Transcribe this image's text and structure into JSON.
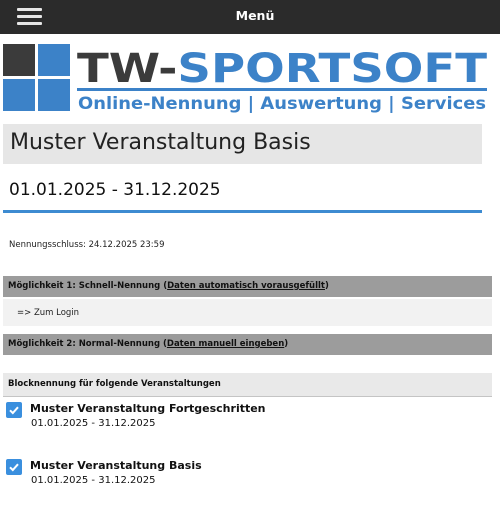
{
  "header": {
    "menu_label": "Menü",
    "menu_icon": "hamburger-menu-icon"
  },
  "logo": {
    "name": "TW-SPORTSOFT",
    "tagline": "Online-Nennung | Auswertung | Services",
    "colors": {
      "dark": "#3b3b3b",
      "blue": "#3c82c8"
    }
  },
  "event": {
    "title": "Muster Veranstaltung Basis",
    "dates": "01.01.2025 - 31.12.2025",
    "deadline": "Nennungsschluss: 24.12.2025 23:59"
  },
  "options": {
    "option1_prefix": "Möglichkeit 1: Schnell-Nennung (",
    "option1_link": "Daten automatisch vorausgefüllt",
    "option1_suffix": ")",
    "login_link": "=> Zum Login",
    "option2_prefix": "Möglichkeit 2: Normal-Nennung (",
    "option2_link": "Daten manuell eingeben",
    "option2_suffix": ")"
  },
  "block": {
    "heading": "Blocknennung für folgende Veranstaltungen",
    "items": [
      {
        "name": "Muster Veranstaltung Fortgeschritten",
        "dates": "01.01.2025 - 31.12.2025",
        "checked": true
      },
      {
        "name": "Muster Veranstaltung Basis",
        "dates": "01.01.2025 - 31.12.2025",
        "checked": true
      }
    ]
  },
  "colors": {
    "topbar": "#2b2b2b",
    "accent_blue": "#3d8bd1",
    "checkbox_blue": "#3a8fde",
    "option_bar": "#9c9c9c"
  }
}
